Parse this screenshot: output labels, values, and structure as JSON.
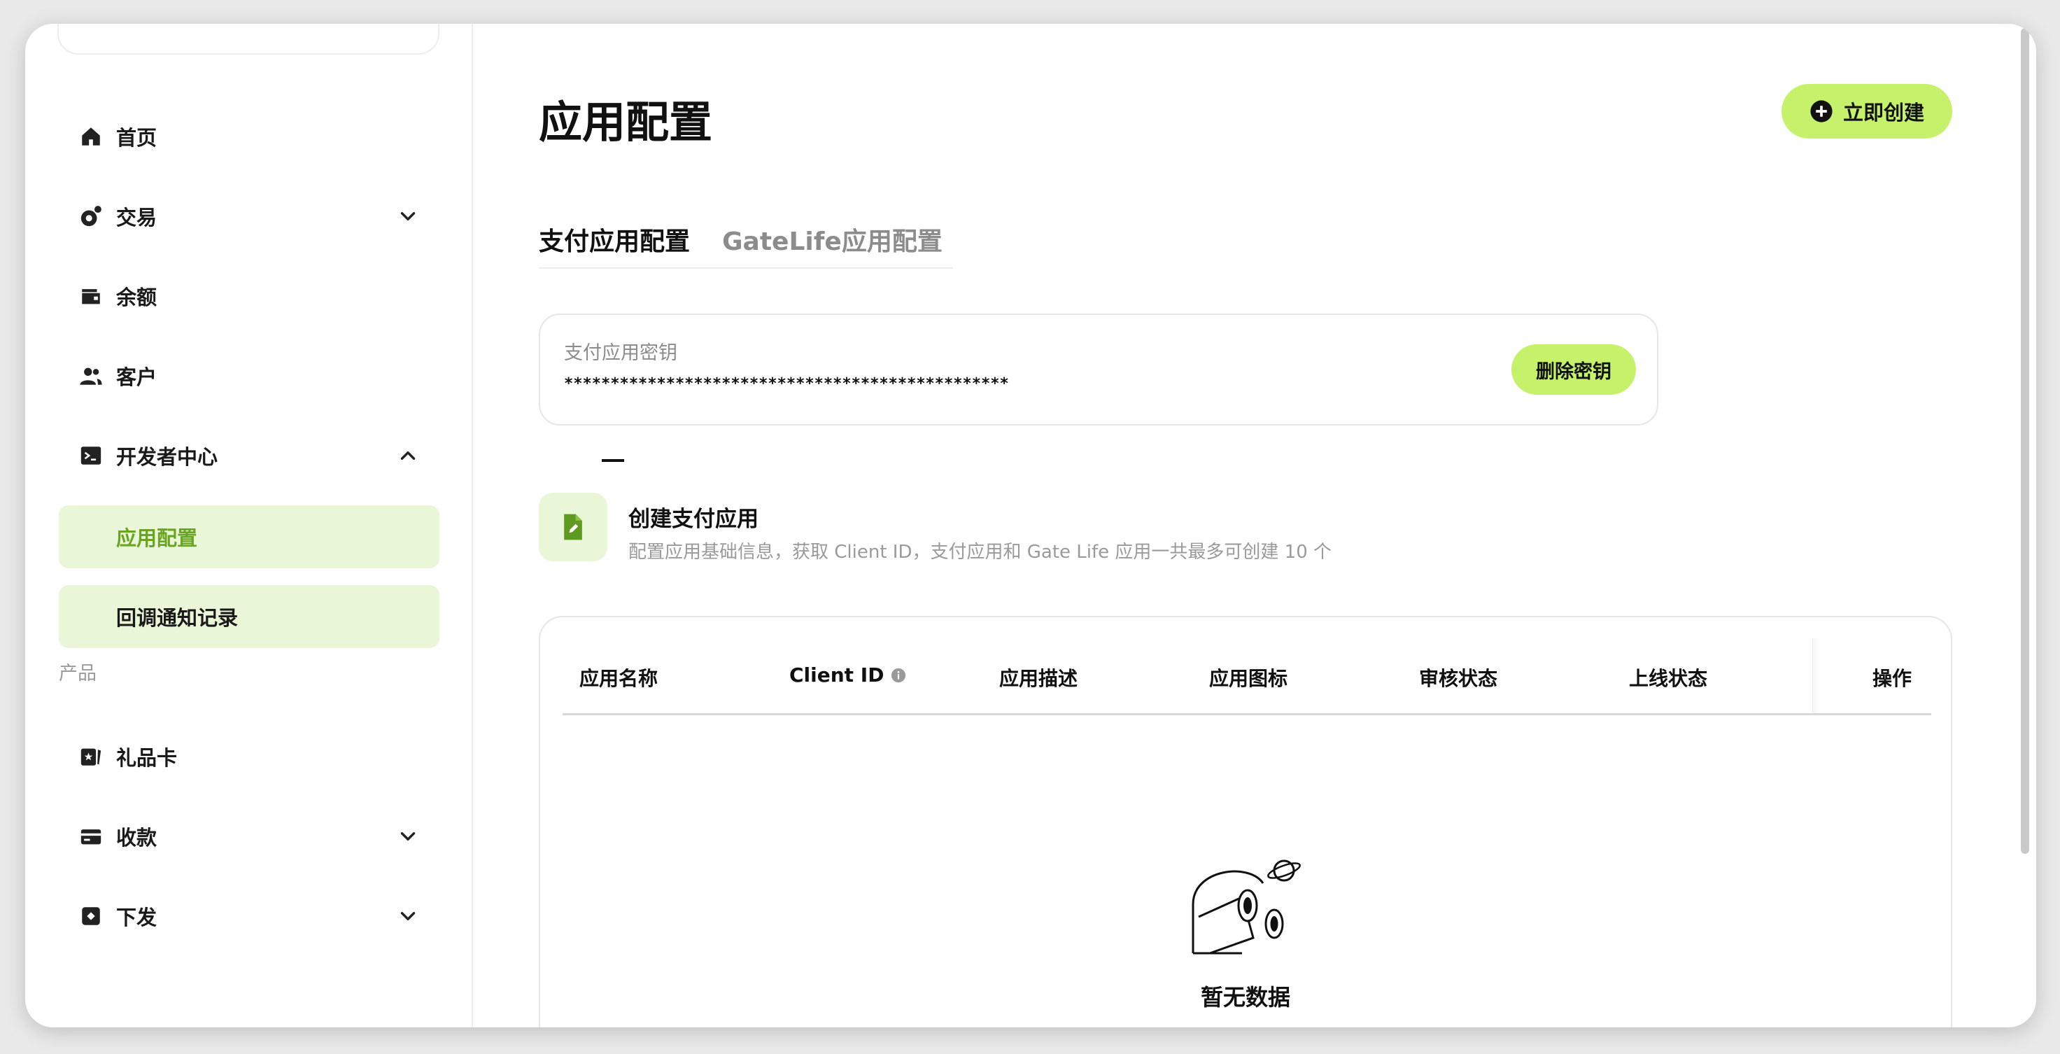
{
  "sidebar": {
    "items": [
      {
        "label": "首页",
        "icon": "home-icon"
      },
      {
        "label": "交易",
        "icon": "transaction-icon"
      },
      {
        "label": "余额",
        "icon": "wallet-icon"
      },
      {
        "label": "客户",
        "icon": "users-icon"
      },
      {
        "label": "开发者中心",
        "icon": "terminal-icon"
      }
    ],
    "dev_subitems": [
      {
        "label": "应用配置",
        "active": true
      },
      {
        "label": "回调通知记录",
        "active": false
      }
    ],
    "section_products": "产品",
    "product_items": [
      {
        "label": "礼品卡",
        "icon": "gift-card-icon"
      },
      {
        "label": "收款",
        "icon": "card-icon"
      },
      {
        "label": "下发",
        "icon": "payout-icon"
      }
    ]
  },
  "main": {
    "title": "应用配置",
    "create_button": "立即创建",
    "tabs": [
      {
        "label": "支付应用配置",
        "active": true
      },
      {
        "label": "GateLife应用配置",
        "active": false
      }
    ],
    "secret": {
      "label": "支付应用密钥",
      "value": "************************************************",
      "delete_button": "删除密钥"
    },
    "create_app": {
      "title": "创建支付应用",
      "description": "配置应用基础信息，获取 Client ID，支付应用和 Gate Life 应用一共最多可创建 10 个"
    },
    "table": {
      "columns": [
        "应用名称",
        "Client ID",
        "应用描述",
        "应用图标",
        "审核状态",
        "上线状态",
        "操作"
      ],
      "empty_text": "暂无数据"
    }
  },
  "colors": {
    "accent": "#c5f26a",
    "accent_soft": "#e9f6d8",
    "active_text": "#6aa521"
  }
}
